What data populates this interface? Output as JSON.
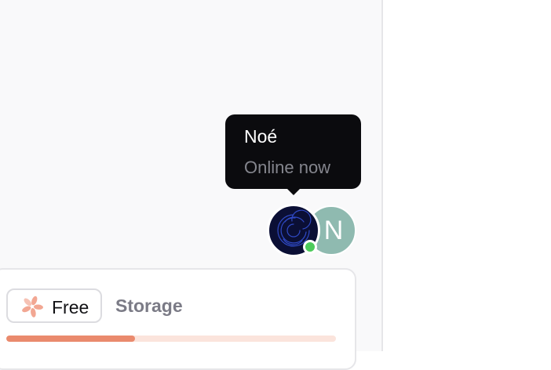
{
  "tooltip": {
    "name": "Noé",
    "status": "Online now"
  },
  "avatars": [
    {
      "label": "Noé",
      "status": "online"
    },
    {
      "label": "N"
    }
  ],
  "plan": {
    "badge_label": "Free",
    "storage_label": "Storage",
    "storage_used_fraction": 0.39
  },
  "colors": {
    "tooltip_bg": "#0b0b0e",
    "online": "#4ccb5a",
    "progress_fill": "#ea8a6d",
    "progress_track": "#fbe4dc",
    "avatar_n_bg": "#8fbab0"
  }
}
